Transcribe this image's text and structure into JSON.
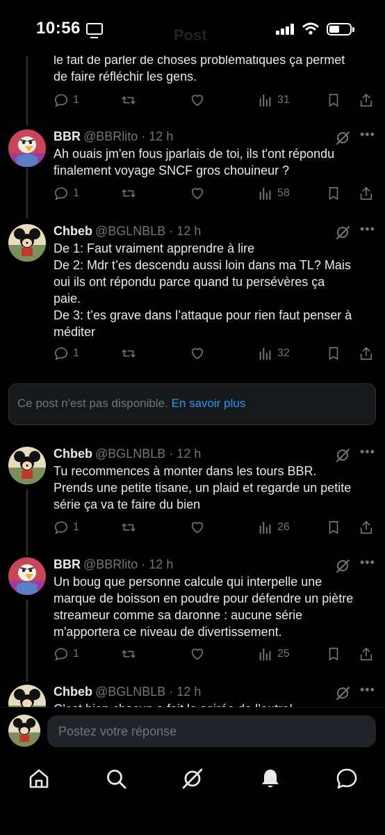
{
  "status_bar": {
    "time": "10:56",
    "ghost_title": "Post"
  },
  "tweets": [
    {
      "name": "",
      "handle": "",
      "time": "",
      "text": "le fait de parler de choses problématiques ça permet\nde faire réfléchir les gens.",
      "replies": "1",
      "views": "31"
    },
    {
      "name": "BBR",
      "handle": "@BBRlito",
      "time": " · 12 h",
      "text": "Ah ouais jm'en fous jparlais de toi, ils t'ont répondu\nfinalement voyage SNCF gros chouineur ?",
      "replies": "1",
      "views": "58"
    },
    {
      "name": "Chbeb",
      "handle": "@BGLNBLB",
      "time": " · 12 h",
      "text": "De 1: Faut vraiment apprendre à lire\nDe 2: Mdr t’es descendu aussi loin dans ma TL? Mais\noui ils ont répondu parce quand tu persévères ça\npaie.\nDe 3: t’es grave dans l’attaque pour rien faut penser à\nméditer",
      "replies": "1",
      "views": "32"
    },
    {
      "name": "Chbeb",
      "handle": "@BGLNBLB",
      "time": " · 12 h",
      "text": "Tu recommences à monter dans les tours BBR.\nPrends une petite tisane, un plaid et regarde un petite\nsérie ça va te faire du bien",
      "replies": "1",
      "views": "26"
    },
    {
      "name": "BBR",
      "handle": "@BBRlito",
      "time": " · 12 h",
      "text": "Un boug que personne calcule qui interpelle une\nmarque de boisson en poudre pour défendre un piètre\nstreameur comme sa daronne : aucune série\nm'apportera ce niveau de divertissement.",
      "replies": "1",
      "views": "25"
    },
    {
      "name": "Chbeb",
      "handle": "@BGLNBLB",
      "time": " · 12 h",
      "text": "C’est bien chacun a fait la soirée de l’autre!"
    }
  ],
  "unavailable": {
    "text": "Ce post n'est pas disponible. ",
    "link": "En savoir plus"
  },
  "reply": {
    "placeholder": "Postez votre réponse"
  },
  "icons": {
    "reply": "reply-icon",
    "retweet": "retweet-icon",
    "like": "heart-icon",
    "views": "views-icon",
    "bookmark": "bookmark-icon",
    "share": "share-icon",
    "grok": "grok-icon",
    "more": "more-icon"
  },
  "colors": {
    "background": "#000000",
    "text": "#e7e9ea",
    "muted": "#71767b",
    "link": "#1d9bf0"
  }
}
